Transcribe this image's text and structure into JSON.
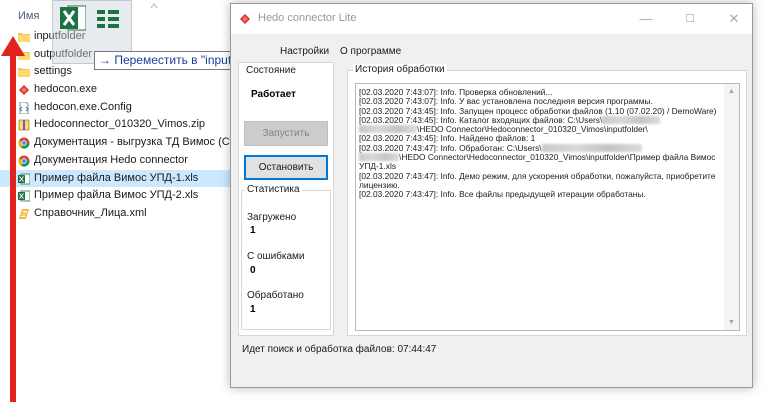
{
  "explorer": {
    "column_header": "Имя",
    "files": [
      {
        "name": "inputfolder",
        "icon": "folder-icon",
        "selected": false
      },
      {
        "name": "outputfolder",
        "icon": "folder-icon",
        "selected": false
      },
      {
        "name": "settings",
        "icon": "folder-icon",
        "selected": false
      },
      {
        "name": "hedocon.exe",
        "icon": "app-icon",
        "selected": false
      },
      {
        "name": "hedocon.exe.Config",
        "icon": "config-file-icon",
        "selected": false
      },
      {
        "name": "Hedoconnector_010320_Vimos.zip",
        "icon": "zip-icon",
        "selected": false
      },
      {
        "name": "Документация - выгрузка ТД Вимос (Стро",
        "icon": "chrome-doc-icon",
        "selected": false
      },
      {
        "name": "Документация Hedo connector",
        "icon": "chrome-doc-icon",
        "selected": false
      },
      {
        "name": "Пример файла Вимос УПД-1.xls",
        "icon": "excel-icon",
        "selected": true
      },
      {
        "name": "Пример файла Вимос УПД-2.xls",
        "icon": "excel-icon",
        "selected": false
      },
      {
        "name": "Справочник_Лица.xml",
        "icon": "xml-icon",
        "selected": false
      }
    ],
    "drag_tooltip": "→ Переместить в \"inputfolder\""
  },
  "window": {
    "title": "Hedo connector Lite",
    "controls": {
      "minimize": "—",
      "maximize": "☐",
      "close": "✕"
    },
    "menu": [
      "Настройки",
      "О программе"
    ],
    "state": {
      "group_title": "Состояние",
      "value": "Работает"
    },
    "buttons": {
      "start": "Запустить",
      "stop": "Остановить"
    },
    "stats": {
      "group_title": "Статистика",
      "loaded_label": "Загружено",
      "loaded_value": "1",
      "errors_label": "С ошибками",
      "errors_value": "0",
      "processed_label": "Обработано",
      "processed_value": "1"
    },
    "history": {
      "group_title": "История обработки",
      "lines": [
        "[02.03.2020 7:43:07]: Info. Проверка обновлений...",
        "[02.03.2020 7:43:07]: Info. У вас установлена последняя версия программы.",
        "[02.03.2020 7:43:45]: Info. Запущен процесс обработки файлов (1.10 (07.02.20) / DemoWare)",
        "[02.03.2020 7:43:45]: Info. Каталог входящих файлов: C:\\Users\\",
        "\\HEDO Connector\\Hedoconnector_010320_Vimos\\inputfolder\\",
        "[02.03.2020 7:43:45]: Info. Найдено файлов: 1",
        "[02.03.2020 7:43:47]: Info. Обработан: C:\\Users\\",
        "\\HEDO Connector\\Hedoconnector_010320_Vimos\\inputfolder\\Пример файла Вимос УПД-1.xls",
        "[02.03.2020 7:43:47]: Info. Демо режим, для ускорения обработки, пожалуйста, приобретите лицензию.",
        "[02.03.2020 7:43:47]: Info. Все файлы предыдущей итерации обработаны."
      ]
    },
    "status_bar": "Идет поиск и обработка файлов: 07:44:47"
  },
  "colors": {
    "selection": "#cce8ff",
    "tooltip_text": "#1a3c9e",
    "arrow": "#e0241b",
    "excel_green": "#1e7145",
    "button_focus": "#0078d7"
  }
}
